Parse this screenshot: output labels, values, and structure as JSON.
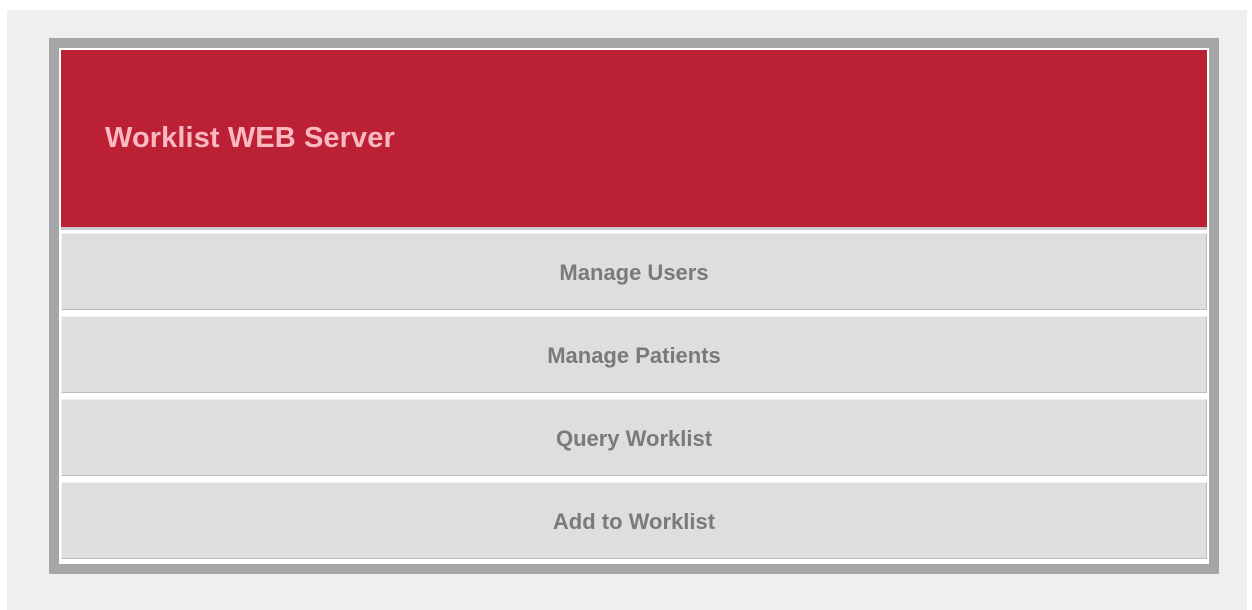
{
  "header": {
    "title": "Worklist WEB Server"
  },
  "menu": {
    "items": [
      {
        "label": "Manage Users"
      },
      {
        "label": "Manage Patients"
      },
      {
        "label": "Query Worklist"
      },
      {
        "label": "Add to Worklist"
      }
    ]
  },
  "colors": {
    "header_bg": "#bb2035",
    "header_text": "#fbb8c0",
    "button_bg": "#dedede",
    "button_text": "#7a7a7a",
    "frame": "#a6a6a6"
  }
}
